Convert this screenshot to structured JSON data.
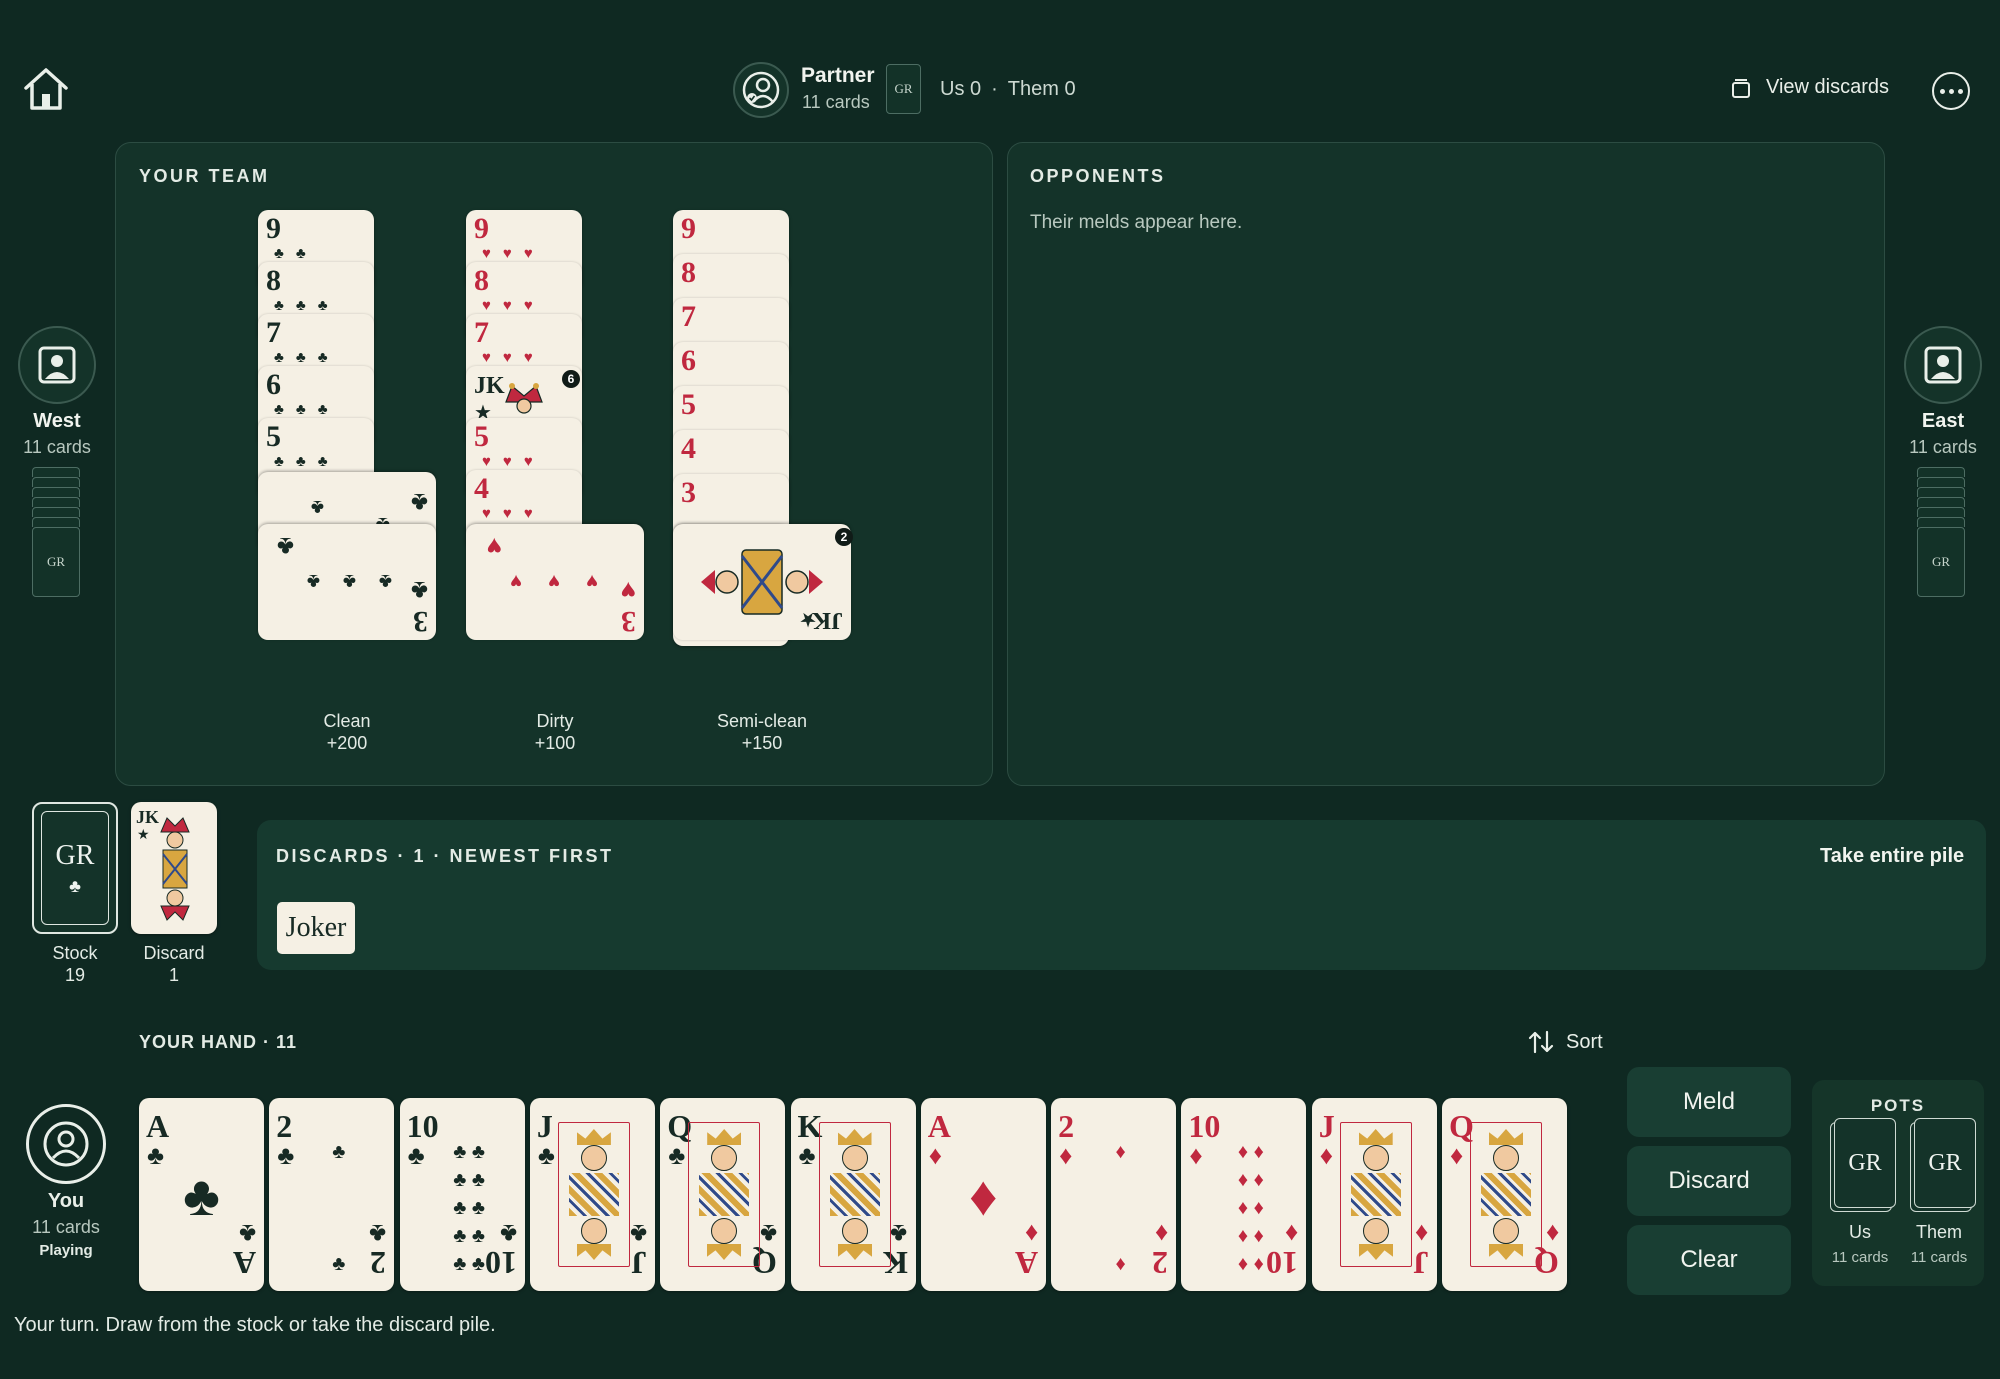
{
  "top_bar": {
    "partner_name": "Partner",
    "partner_count": "11 cards",
    "card_back_mark": "GR",
    "score_us": "Us 0",
    "score_separator": "·",
    "score_them": "Them 0",
    "view_discards": "View discards"
  },
  "west": {
    "name": "West",
    "count": "11 cards",
    "back_mark": "GR"
  },
  "east": {
    "name": "East",
    "count": "11 cards",
    "back_mark": "GR"
  },
  "team_panel": {
    "title": "YOUR TEAM",
    "melds": [
      {
        "cards": [
          "9",
          "8",
          "7",
          "6",
          "5",
          "4",
          "3"
        ],
        "label": "Clean",
        "points": "+200"
      },
      {
        "cards": [
          "9",
          "8",
          "7",
          "JK",
          "5",
          "4",
          "3"
        ],
        "badge": "6",
        "label": "Dirty",
        "points": "+100"
      },
      {
        "cards": [
          "9",
          "8",
          "7",
          "6",
          "5",
          "4",
          "3",
          "JK"
        ],
        "badge": "2",
        "label": "Semi-clean",
        "points": "+150"
      }
    ]
  },
  "opponents_panel": {
    "title": "OPPONENTS",
    "placeholder": "Their melds appear here."
  },
  "stock": {
    "mark": "GR",
    "label": "Stock",
    "count": "19"
  },
  "discard": {
    "top_card": "JK",
    "label": "Discard",
    "count": "1"
  },
  "discard_strip": {
    "title": "DISCARDS · 1 · NEWEST FIRST",
    "take_label": "Take entire pile",
    "items": [
      "Joker"
    ]
  },
  "hand": {
    "title": "YOUR HAND · 11",
    "sort_label": "Sort",
    "cards": [
      {
        "rank": "A",
        "suit": "clubs",
        "symbol": "♣"
      },
      {
        "rank": "2",
        "suit": "clubs",
        "symbol": "♣"
      },
      {
        "rank": "10",
        "suit": "clubs",
        "symbol": "♣"
      },
      {
        "rank": "J",
        "suit": "clubs",
        "symbol": "♣"
      },
      {
        "rank": "Q",
        "suit": "clubs",
        "symbol": "♣"
      },
      {
        "rank": "K",
        "suit": "clubs",
        "symbol": "♣"
      },
      {
        "rank": "A",
        "suit": "diamonds",
        "symbol": "♦"
      },
      {
        "rank": "2",
        "suit": "diamonds",
        "symbol": "♦"
      },
      {
        "rank": "10",
        "suit": "diamonds",
        "symbol": "♦"
      },
      {
        "rank": "J",
        "suit": "diamonds",
        "symbol": "♦"
      },
      {
        "rank": "Q",
        "suit": "diamonds",
        "symbol": "♦"
      }
    ]
  },
  "you": {
    "name": "You",
    "count": "11 cards",
    "status": "Playing"
  },
  "actions": {
    "meld": "Meld",
    "discard": "Discard",
    "clear": "Clear"
  },
  "pots": {
    "title": "POTS",
    "us": {
      "mark": "GR",
      "label": "Us",
      "count": "11 cards"
    },
    "them": {
      "mark": "GR",
      "label": "Them",
      "count": "11 cards"
    }
  },
  "status_message": "Your turn. Draw from the stock or take the discard pile.",
  "colors": {
    "background": "#0f2922",
    "panel": "#143329",
    "card_face": "#f5f0e4",
    "red_suit": "#c0283f",
    "black_suit": "#172a24"
  }
}
